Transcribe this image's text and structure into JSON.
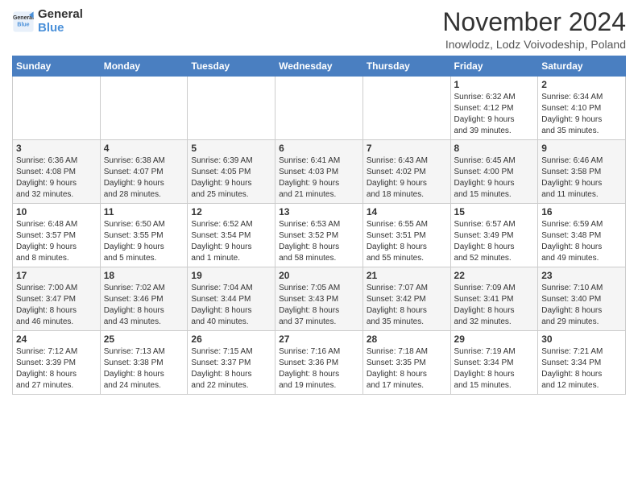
{
  "logo": {
    "line1": "General",
    "line2": "Blue"
  },
  "title": "November 2024",
  "subtitle": "Inowlodz, Lodz Voivodeship, Poland",
  "days_of_week": [
    "Sunday",
    "Monday",
    "Tuesday",
    "Wednesday",
    "Thursday",
    "Friday",
    "Saturday"
  ],
  "weeks": [
    [
      {
        "day": "",
        "info": ""
      },
      {
        "day": "",
        "info": ""
      },
      {
        "day": "",
        "info": ""
      },
      {
        "day": "",
        "info": ""
      },
      {
        "day": "",
        "info": ""
      },
      {
        "day": "1",
        "info": "Sunrise: 6:32 AM\nSunset: 4:12 PM\nDaylight: 9 hours\nand 39 minutes."
      },
      {
        "day": "2",
        "info": "Sunrise: 6:34 AM\nSunset: 4:10 PM\nDaylight: 9 hours\nand 35 minutes."
      }
    ],
    [
      {
        "day": "3",
        "info": "Sunrise: 6:36 AM\nSunset: 4:08 PM\nDaylight: 9 hours\nand 32 minutes."
      },
      {
        "day": "4",
        "info": "Sunrise: 6:38 AM\nSunset: 4:07 PM\nDaylight: 9 hours\nand 28 minutes."
      },
      {
        "day": "5",
        "info": "Sunrise: 6:39 AM\nSunset: 4:05 PM\nDaylight: 9 hours\nand 25 minutes."
      },
      {
        "day": "6",
        "info": "Sunrise: 6:41 AM\nSunset: 4:03 PM\nDaylight: 9 hours\nand 21 minutes."
      },
      {
        "day": "7",
        "info": "Sunrise: 6:43 AM\nSunset: 4:02 PM\nDaylight: 9 hours\nand 18 minutes."
      },
      {
        "day": "8",
        "info": "Sunrise: 6:45 AM\nSunset: 4:00 PM\nDaylight: 9 hours\nand 15 minutes."
      },
      {
        "day": "9",
        "info": "Sunrise: 6:46 AM\nSunset: 3:58 PM\nDaylight: 9 hours\nand 11 minutes."
      }
    ],
    [
      {
        "day": "10",
        "info": "Sunrise: 6:48 AM\nSunset: 3:57 PM\nDaylight: 9 hours\nand 8 minutes."
      },
      {
        "day": "11",
        "info": "Sunrise: 6:50 AM\nSunset: 3:55 PM\nDaylight: 9 hours\nand 5 minutes."
      },
      {
        "day": "12",
        "info": "Sunrise: 6:52 AM\nSunset: 3:54 PM\nDaylight: 9 hours\nand 1 minute."
      },
      {
        "day": "13",
        "info": "Sunrise: 6:53 AM\nSunset: 3:52 PM\nDaylight: 8 hours\nand 58 minutes."
      },
      {
        "day": "14",
        "info": "Sunrise: 6:55 AM\nSunset: 3:51 PM\nDaylight: 8 hours\nand 55 minutes."
      },
      {
        "day": "15",
        "info": "Sunrise: 6:57 AM\nSunset: 3:49 PM\nDaylight: 8 hours\nand 52 minutes."
      },
      {
        "day": "16",
        "info": "Sunrise: 6:59 AM\nSunset: 3:48 PM\nDaylight: 8 hours\nand 49 minutes."
      }
    ],
    [
      {
        "day": "17",
        "info": "Sunrise: 7:00 AM\nSunset: 3:47 PM\nDaylight: 8 hours\nand 46 minutes."
      },
      {
        "day": "18",
        "info": "Sunrise: 7:02 AM\nSunset: 3:46 PM\nDaylight: 8 hours\nand 43 minutes."
      },
      {
        "day": "19",
        "info": "Sunrise: 7:04 AM\nSunset: 3:44 PM\nDaylight: 8 hours\nand 40 minutes."
      },
      {
        "day": "20",
        "info": "Sunrise: 7:05 AM\nSunset: 3:43 PM\nDaylight: 8 hours\nand 37 minutes."
      },
      {
        "day": "21",
        "info": "Sunrise: 7:07 AM\nSunset: 3:42 PM\nDaylight: 8 hours\nand 35 minutes."
      },
      {
        "day": "22",
        "info": "Sunrise: 7:09 AM\nSunset: 3:41 PM\nDaylight: 8 hours\nand 32 minutes."
      },
      {
        "day": "23",
        "info": "Sunrise: 7:10 AM\nSunset: 3:40 PM\nDaylight: 8 hours\nand 29 minutes."
      }
    ],
    [
      {
        "day": "24",
        "info": "Sunrise: 7:12 AM\nSunset: 3:39 PM\nDaylight: 8 hours\nand 27 minutes."
      },
      {
        "day": "25",
        "info": "Sunrise: 7:13 AM\nSunset: 3:38 PM\nDaylight: 8 hours\nand 24 minutes."
      },
      {
        "day": "26",
        "info": "Sunrise: 7:15 AM\nSunset: 3:37 PM\nDaylight: 8 hours\nand 22 minutes."
      },
      {
        "day": "27",
        "info": "Sunrise: 7:16 AM\nSunset: 3:36 PM\nDaylight: 8 hours\nand 19 minutes."
      },
      {
        "day": "28",
        "info": "Sunrise: 7:18 AM\nSunset: 3:35 PM\nDaylight: 8 hours\nand 17 minutes."
      },
      {
        "day": "29",
        "info": "Sunrise: 7:19 AM\nSunset: 3:34 PM\nDaylight: 8 hours\nand 15 minutes."
      },
      {
        "day": "30",
        "info": "Sunrise: 7:21 AM\nSunset: 3:34 PM\nDaylight: 8 hours\nand 12 minutes."
      }
    ]
  ]
}
